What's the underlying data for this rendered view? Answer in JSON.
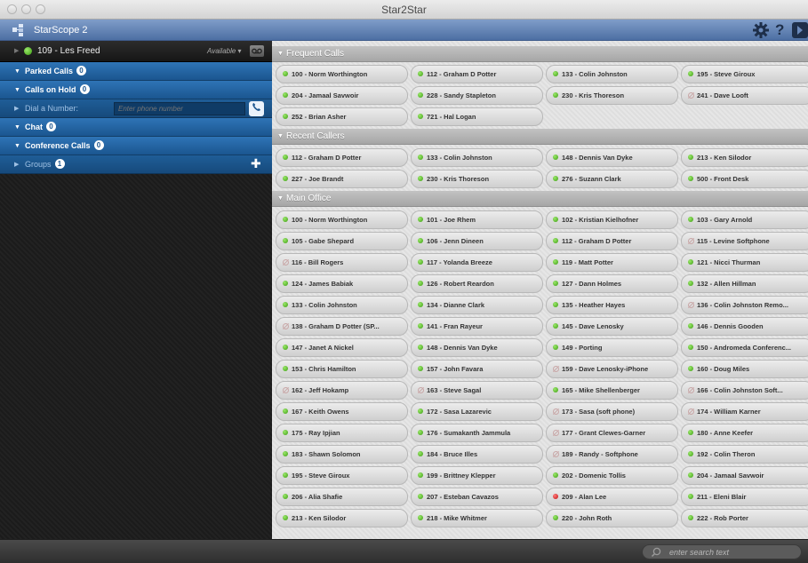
{
  "window": {
    "title": "Star2Star"
  },
  "header": {
    "app_name": "StarScope 2",
    "settings_icon": "gear-icon",
    "help_label": "?",
    "panel_icon": "panel-toggle-icon"
  },
  "left": {
    "user": {
      "name": "109 - Les Freed",
      "status": "Available",
      "status_color": "#3c9d12"
    },
    "parked": {
      "label": "Parked Calls",
      "count": "0"
    },
    "hold": {
      "label": "Calls on Hold",
      "count": "0"
    },
    "dial": {
      "label": "Dial a Number:",
      "placeholder": "Enter phone number"
    },
    "chat": {
      "label": "Chat",
      "count": "0"
    },
    "conference": {
      "label": "Conference Calls",
      "count": "0"
    },
    "groups": {
      "label": "Groups",
      "count": "1"
    }
  },
  "sections": [
    {
      "title": "Frequent Calls",
      "contacts": [
        {
          "label": "100 - Norm Worthington",
          "status": "green"
        },
        {
          "label": "112 - Graham D Potter",
          "status": "green"
        },
        {
          "label": "133 - Colin Johnston",
          "status": "green"
        },
        {
          "label": "195 - Steve Giroux",
          "status": "green"
        },
        {
          "label": "204 - Jamaal Savwoir",
          "status": "green"
        },
        {
          "label": "228 - Sandy Stapleton",
          "status": "green"
        },
        {
          "label": "230 - Kris Thoreson",
          "status": "green"
        },
        {
          "label": "241 - Dave Looft",
          "status": "off"
        },
        {
          "label": "252 - Brian Asher",
          "status": "green"
        },
        {
          "label": "721 - Hal Logan",
          "status": "green"
        }
      ]
    },
    {
      "title": "Recent Callers",
      "contacts": [
        {
          "label": "112 - Graham D Potter",
          "status": "green"
        },
        {
          "label": "133 - Colin Johnston",
          "status": "green"
        },
        {
          "label": "148 - Dennis Van Dyke",
          "status": "green"
        },
        {
          "label": "213 - Ken Silodor",
          "status": "green"
        },
        {
          "label": "227 - Joe Brandt",
          "status": "green"
        },
        {
          "label": "230 - Kris Thoreson",
          "status": "green"
        },
        {
          "label": "276 - Suzann Clark",
          "status": "green"
        },
        {
          "label": "500 - Front Desk",
          "status": "green"
        }
      ]
    },
    {
      "title": "Main Office",
      "contacts": [
        {
          "label": "100 - Norm Worthington",
          "status": "green"
        },
        {
          "label": "101 - Joe Rhem",
          "status": "green"
        },
        {
          "label": "102 - Kristian Kielhofner",
          "status": "green"
        },
        {
          "label": "103 - Gary Arnold",
          "status": "green"
        },
        {
          "label": "105 - Gabe Shepard",
          "status": "green"
        },
        {
          "label": "106 - Jenn Dineen",
          "status": "green"
        },
        {
          "label": "112 - Graham D Potter",
          "status": "green"
        },
        {
          "label": "115 - Levine Softphone",
          "status": "off"
        },
        {
          "label": "116 - Bill Rogers",
          "status": "off"
        },
        {
          "label": "117 - Yolanda Breeze",
          "status": "green"
        },
        {
          "label": "119 - Matt Potter",
          "status": "green"
        },
        {
          "label": "121 - Nicci Thurman",
          "status": "green"
        },
        {
          "label": "124 - James Babiak",
          "status": "green"
        },
        {
          "label": "126 - Robert Reardon",
          "status": "green"
        },
        {
          "label": "127 - Dann Holmes",
          "status": "green"
        },
        {
          "label": "132 - Allen Hillman",
          "status": "green"
        },
        {
          "label": "133 - Colin Johnston",
          "status": "green"
        },
        {
          "label": "134 - Dianne Clark",
          "status": "green"
        },
        {
          "label": "135 - Heather Hayes",
          "status": "green"
        },
        {
          "label": "136 - Colin Johnston Remo...",
          "status": "off"
        },
        {
          "label": "138 - Graham D Potter (SP...",
          "status": "off"
        },
        {
          "label": "141 - Fran Rayeur",
          "status": "green"
        },
        {
          "label": "145 - Dave Lenosky",
          "status": "green"
        },
        {
          "label": "146 - Dennis Gooden",
          "status": "green"
        },
        {
          "label": "147 - Janet A Nickel",
          "status": "green"
        },
        {
          "label": "148 - Dennis Van Dyke",
          "status": "green"
        },
        {
          "label": "149 - Porting",
          "status": "green"
        },
        {
          "label": "150 - Andromeda Conferenc...",
          "status": "green"
        },
        {
          "label": "153 - Chris Hamilton",
          "status": "green"
        },
        {
          "label": "157 - John Favara",
          "status": "green"
        },
        {
          "label": "159 - Dave Lenosky-iPhone",
          "status": "off"
        },
        {
          "label": "160 - Doug Miles",
          "status": "green"
        },
        {
          "label": "162 - Jeff Hokamp",
          "status": "off"
        },
        {
          "label": "163 - Steve Sagal",
          "status": "off"
        },
        {
          "label": "165 - Mike Shellenberger",
          "status": "green"
        },
        {
          "label": "166 - Colin Johnston Soft...",
          "status": "off"
        },
        {
          "label": "167 - Keith Owens",
          "status": "green"
        },
        {
          "label": "172 - Sasa Lazarevic",
          "status": "green"
        },
        {
          "label": "173 - Sasa (soft phone)",
          "status": "off"
        },
        {
          "label": "174 - William Karner",
          "status": "off"
        },
        {
          "label": "175 - Ray Ipjian",
          "status": "green"
        },
        {
          "label": "176 - Sumakanth Jammula",
          "status": "green"
        },
        {
          "label": "177 - Grant Clewes-Garner",
          "status": "off"
        },
        {
          "label": "180 - Anne Keefer",
          "status": "green"
        },
        {
          "label": "183 - Shawn Solomon",
          "status": "green"
        },
        {
          "label": "184 - Bruce Illes",
          "status": "green"
        },
        {
          "label": "189 - Randy - Softphone",
          "status": "off"
        },
        {
          "label": "192 - Colin Theron",
          "status": "green"
        },
        {
          "label": "195 - Steve Giroux",
          "status": "green"
        },
        {
          "label": "199 - Brittney Klepper",
          "status": "green"
        },
        {
          "label": "202 - Domenic Tollis",
          "status": "green"
        },
        {
          "label": "204 - Jamaal Savwoir",
          "status": "green"
        },
        {
          "label": "206 - Alia Shafie",
          "status": "green"
        },
        {
          "label": "207 - Esteban Cavazos",
          "status": "green"
        },
        {
          "label": "209 - Alan Lee",
          "status": "red"
        },
        {
          "label": "211 - Eleni Blair",
          "status": "green"
        },
        {
          "label": "213 - Ken Silodor",
          "status": "green"
        },
        {
          "label": "218 - Mike Whitmer",
          "status": "green"
        },
        {
          "label": "220 - John Roth",
          "status": "green"
        },
        {
          "label": "222 - Rob Porter",
          "status": "green"
        }
      ]
    }
  ],
  "footer": {
    "search_placeholder": "enter search text"
  }
}
